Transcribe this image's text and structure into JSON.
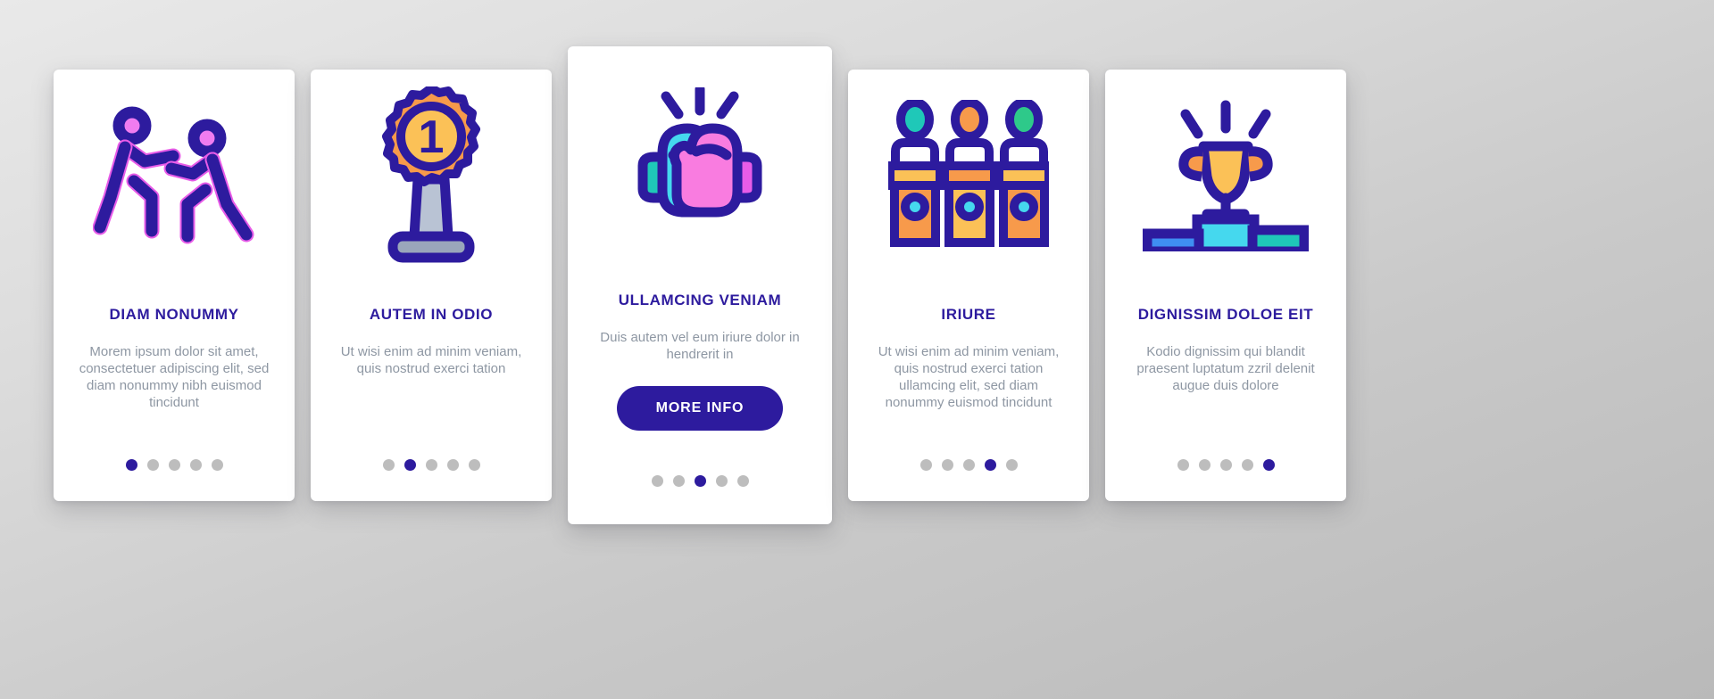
{
  "theme": {
    "background_gradient_from": "#e9e9e9",
    "background_gradient_to": "#b9b9b9",
    "card_background": "#ffffff",
    "title_color": "#2d1b9e",
    "body_text_color": "#8e97a3",
    "accent": "#2d1b9e",
    "dot_inactive": "#bdbdbd",
    "icon_outline": "#2d1b9e",
    "icon_pink": "#f07cf0",
    "icon_magenta": "#e85ce8",
    "icon_cyan": "#45d8ee",
    "icon_teal": "#1fc8b8",
    "icon_orange": "#f79a4b",
    "icon_yellow": "#fbc157",
    "icon_gray": "#9aa6bb",
    "icon_blue": "#3f8ef2",
    "icon_green": "#2ec98a",
    "icon_white": "#ffffff"
  },
  "cards": [
    {
      "id": "card-1",
      "icon_name": "two-runners-icon",
      "title": "DIAM NONUMMY",
      "description": "Morem ipsum dolor sit amet, consectetuer adipiscing elit, sed diam nonummy nibh euismod tincidunt",
      "dots_total": 5,
      "dot_active_index": 1,
      "has_cta": false
    },
    {
      "id": "card-2",
      "icon_name": "first-place-award-trophy-icon",
      "title": "AUTEM IN ODIO",
      "description": "Ut wisi enim ad minim veniam, quis nostrud exerci tation",
      "medal_number": "1",
      "dots_total": 5,
      "dot_active_index": 2,
      "has_cta": false
    },
    {
      "id": "card-3",
      "icon_name": "boxing-gloves-icon",
      "title": "ULLAMCING VENIAM",
      "description": "Duis autem vel eum iriure dolor in hendrerit in",
      "cta_label": "MORE INFO",
      "dots_total": 5,
      "dot_active_index": 3,
      "has_cta": true
    },
    {
      "id": "card-4",
      "icon_name": "three-speakers-podium-icon",
      "title": "IRIURE",
      "description": "Ut wisi enim ad minim veniam, quis nostrud exerci tation ullamcing elit, sed diam nonummy euismod tincidunt",
      "dots_total": 5,
      "dot_active_index": 4,
      "has_cta": false
    },
    {
      "id": "card-5",
      "icon_name": "trophy-winners-podium-icon",
      "title": "DIGNISSIM DOLOE EIT",
      "description": "Kodio dignissim qui blandit praesent luptatum zzril delenit augue duis dolore",
      "dots_total": 5,
      "dot_active_index": 5,
      "has_cta": false
    }
  ]
}
